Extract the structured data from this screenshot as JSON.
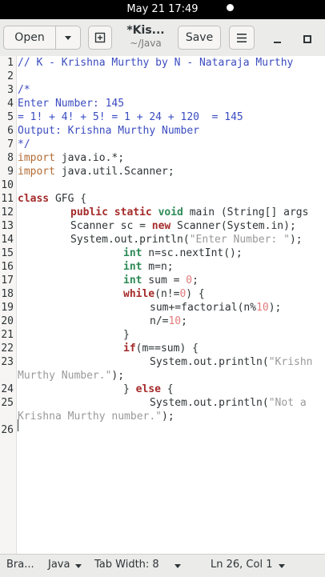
{
  "system": {
    "clock": "May 21  17:49"
  },
  "header": {
    "open_label": "Open",
    "title": "*Kis...",
    "subtitle": "~/Java",
    "save_label": "Save"
  },
  "editor": {
    "line_numbers": [
      "1",
      "2",
      "3",
      "4",
      "5",
      "6",
      "7",
      "8",
      "9",
      "10",
      "11",
      "12",
      "13",
      "14",
      "15",
      "16",
      "17",
      "18",
      "19",
      "20",
      "21",
      "22",
      "23",
      "",
      "24",
      "25",
      "",
      "26"
    ],
    "lines": {
      "l1": "// K - Krishna Murthy by N - Nataraja Murthy",
      "l3": "/*",
      "l4": "Enter Number: 145",
      "l5": "= 1! + 4! + 5! = 1 + 24 + 120  = 145",
      "l6": "Output: Krishna Murthy Number",
      "l7": "*/",
      "l8_kw": "import",
      "l8_rest": " java.io.*;",
      "l9_kw": "import",
      "l9_rest": " java.util.Scanner;",
      "l11_kw": "class",
      "l11_rest": " GFG {",
      "l12_a": "public static",
      "l12_b": "void",
      "l12_c": " main (String[] args",
      "l13_a": "Scanner sc = ",
      "l13_b": "new",
      "l13_c": " Scanner(System.in);",
      "l14_a": "System.out.println(",
      "l14_b": "\"Enter Number: \"",
      "l14_c": ");",
      "l15_a": "int",
      "l15_b": " n=sc.nextInt();",
      "l16_a": "int",
      "l16_b": " m=n;",
      "l17_a": "int",
      "l17_b": " sum = ",
      "l17_c": "0",
      "l17_d": ";",
      "l18_a": "while",
      "l18_b": "(n!=",
      "l18_c": "0",
      "l18_d": ") {",
      "l19_a": "sum+=factorial(n%",
      "l19_b": "10",
      "l19_c": ");",
      "l20_a": "n/=",
      "l20_b": "10",
      "l20_c": ";",
      "l21": "}",
      "l22_a": "if",
      "l22_b": "(m==sum) {",
      "l23_a": "System.out.println(",
      "l23_b": "\"Krishn",
      "l23w": "Murthy Number.\"",
      "l23w_end": ");",
      "l24_a": "} ",
      "l24_b": "else",
      "l24_c": " {",
      "l25_a": "System.out.println(",
      "l25_b": "\"Not a",
      "l25w": "Krishna Murthy number.\"",
      "l25w_end": ");"
    }
  },
  "status": {
    "language_indicator": "Bra...",
    "language": "Java",
    "tab_width": "Tab Width: 8",
    "position": "Ln 26, Col 1"
  }
}
